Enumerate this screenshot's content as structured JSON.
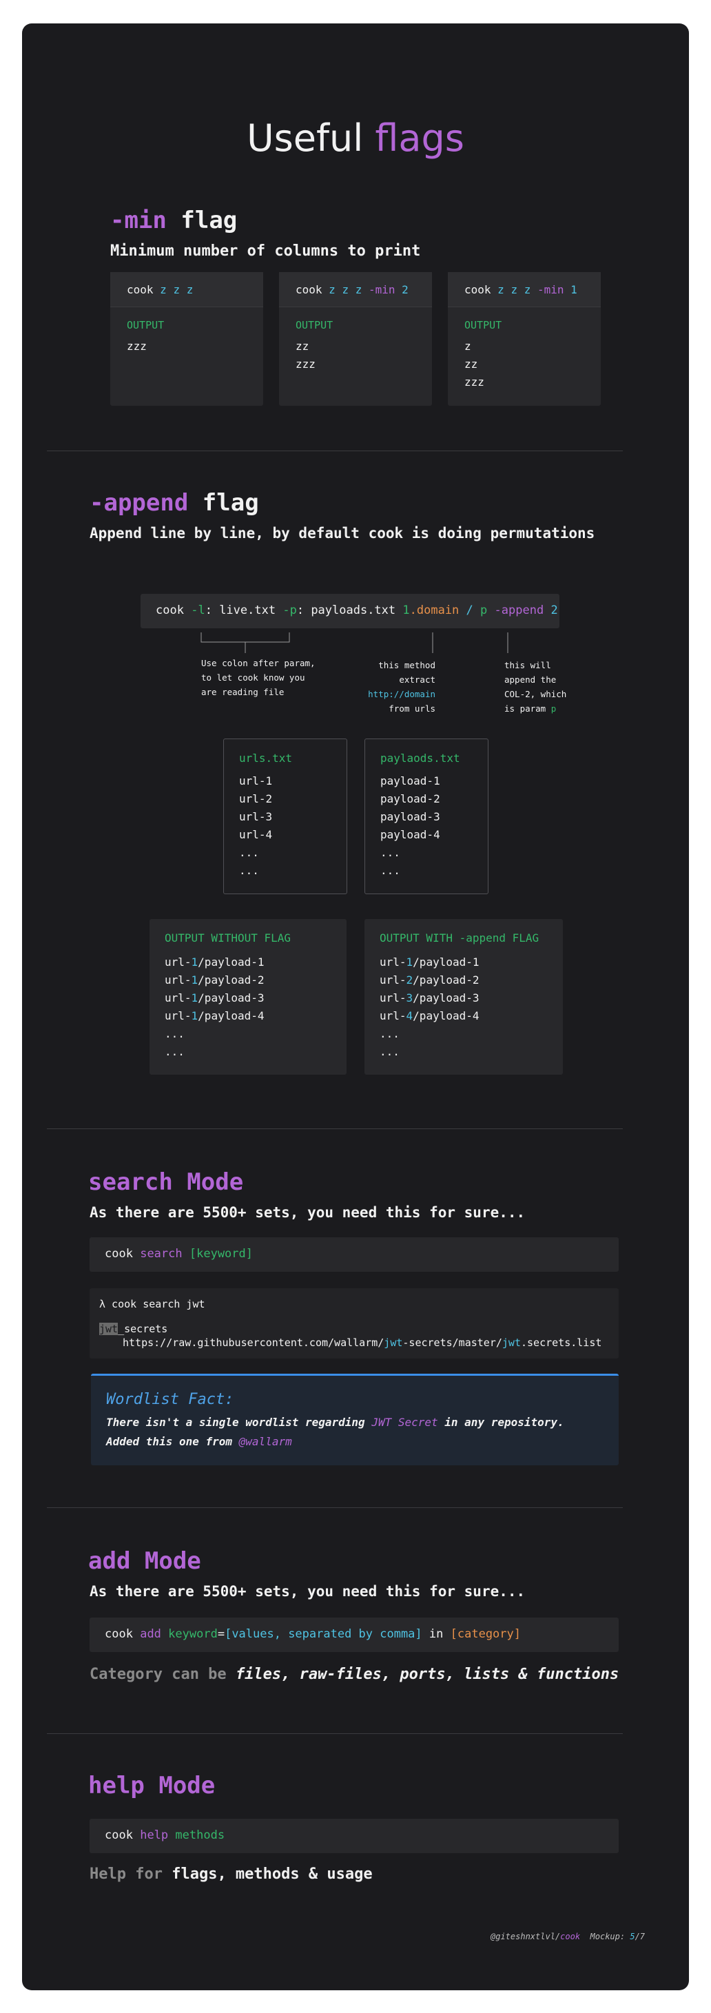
{
  "page_title": {
    "word1": "Useful",
    "word2": "flags"
  },
  "min_flag": {
    "title_flag": "-min",
    "title_word": "flag",
    "subtitle": "Minimum number of columns to print",
    "cards": [
      {
        "cmd": "cook",
        "args": "z z z",
        "flag": "",
        "flag_val": "",
        "output_label": "OUTPUT",
        "lines": [
          "zzz"
        ]
      },
      {
        "cmd": "cook",
        "args": "z z z",
        "flag": "-min",
        "flag_val": "2",
        "output_label": "OUTPUT",
        "lines": [
          "zz",
          "zzz"
        ]
      },
      {
        "cmd": "cook",
        "args": "z z z",
        "flag": "-min",
        "flag_val": "1",
        "output_label": "OUTPUT",
        "lines": [
          "z",
          "zz",
          "zzz"
        ]
      }
    ]
  },
  "append_flag": {
    "title_flag": "-append",
    "title_word": "flag",
    "subtitle": "Append line by line, by default cook is doing permutations",
    "command": {
      "cook": "cook",
      "l_flag": "-l",
      "colon1": ":",
      "file1": "live.txt",
      "p_flag": "-p",
      "colon2": ":",
      "file2": "payloads.txt",
      "num": "1",
      "method": ".domain",
      "slash": "/",
      "p": "p",
      "append": "-append",
      "val": "2"
    },
    "note1": [
      "Use colon after param,",
      "to let cook know you",
      "are reading file"
    ],
    "note2": [
      "this method",
      "extract",
      "http://domain",
      "from urls"
    ],
    "note3": [
      "this will",
      "append the",
      "COL-2, which",
      "is param"
    ],
    "note3_p": "p",
    "urls_file": {
      "name": "urls.txt",
      "lines": [
        "url-1",
        "url-2",
        "url-3",
        "url-4",
        "...",
        "..."
      ]
    },
    "payloads_file": {
      "name": "paylaods.txt",
      "lines": [
        "payload-1",
        "payload-2",
        "payload-3",
        "payload-4",
        "...",
        "..."
      ]
    },
    "out_without": {
      "label": "OUTPUT WITHOUT FLAG",
      "rows": [
        [
          "url-",
          "1",
          "/payload-1"
        ],
        [
          "url-",
          "1",
          "/payload-2"
        ],
        [
          "url-",
          "1",
          "/payload-3"
        ],
        [
          "url-",
          "1",
          "/payload-4"
        ]
      ],
      "tail": [
        "...",
        "..."
      ]
    },
    "out_with": {
      "label": "OUTPUT WITH -append FLAG",
      "rows": [
        [
          "url-",
          "1",
          "/payload-1"
        ],
        [
          "url-",
          "2",
          "/payload-2"
        ],
        [
          "url-",
          "3",
          "/payload-3"
        ],
        [
          "url-",
          "4",
          "/payload-4"
        ]
      ],
      "tail": [
        "...",
        "..."
      ]
    }
  },
  "search_mode": {
    "title": "search Mode",
    "subtitle": "As there are 5500+ sets, you need this for sure...",
    "cmd": {
      "cook": "cook",
      "search": "search",
      "keyword": "[keyword]"
    },
    "terminal": {
      "prompt": "λ cook search jwt",
      "match": "jwt",
      "rest": "_secrets",
      "url_pre": "https://raw.githubusercontent.com/wallarm/",
      "url_hl1": "jwt",
      "url_mid": "-secrets/master/",
      "url_hl2": "jwt",
      "url_post": ".secrets.list"
    },
    "fact": {
      "title": "Wordlist Fact:",
      "line1_pre": "There isn't a single wordlist regarding ",
      "line1_hl": "JWT Secret",
      "line1_post": " in any repository.",
      "line2_pre": "Added this one from ",
      "line2_hl": "@wallarm"
    }
  },
  "add_mode": {
    "title": "add Mode",
    "subtitle": "As there are 5500+ sets, you need this for sure...",
    "cmd": {
      "cook": "cook",
      "add": "add",
      "keyword": "keyword",
      "eq": "=",
      "values": "[values, separated by comma]",
      "in": "in",
      "category": "[category]"
    },
    "category_pre": "Category can be",
    "category_list": "files, raw-files, ports, lists & functions"
  },
  "help_mode": {
    "title": "help Mode",
    "cmd": {
      "cook": "cook",
      "help": "help",
      "methods": "methods"
    },
    "desc_pre": "Help for",
    "desc_post": "flags, methods & usage"
  },
  "footer": {
    "handle": "@giteshnxtlvl/",
    "app": "cook",
    "label": "Mockup:",
    "page": "5",
    "total": "/7"
  },
  "colors": {
    "background": "#1b1b1e",
    "purple": "#b366d6",
    "cyan": "#4fc3e3",
    "green": "#35b86a",
    "orange": "#e8914a",
    "fact_border": "#3b8ee8"
  }
}
